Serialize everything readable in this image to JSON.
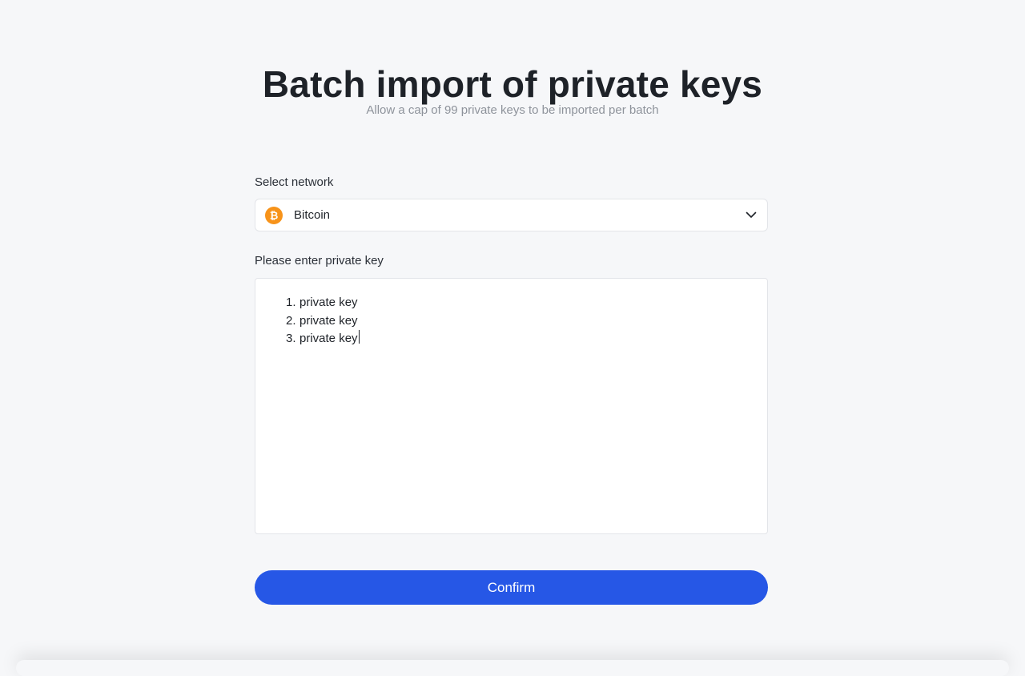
{
  "header": {
    "title": "Batch import of private keys",
    "subtitle": "Allow a cap of 99 private keys to be imported per batch"
  },
  "network": {
    "label": "Select network",
    "selected": "Bitcoin",
    "icon": "bitcoin-icon",
    "icon_color": "#f7931a"
  },
  "private_keys": {
    "label": "Please enter private key",
    "lines": [
      {
        "num": "1.",
        "text": "private key"
      },
      {
        "num": "2.",
        "text": "private key"
      },
      {
        "num": "3.",
        "text": "private key"
      }
    ]
  },
  "confirm": {
    "label": "Confirm",
    "color": "#2657e6"
  }
}
